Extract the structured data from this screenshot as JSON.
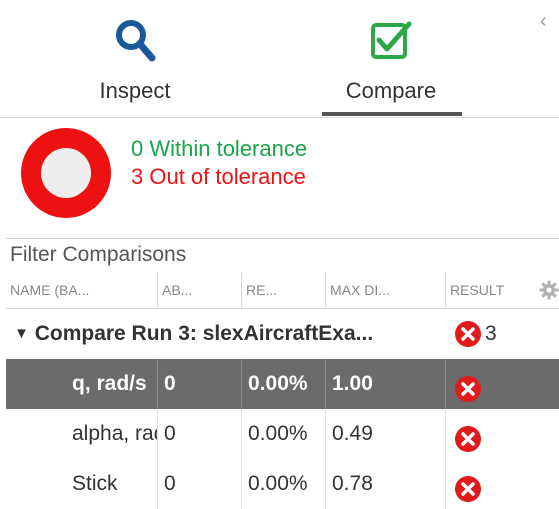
{
  "tabs": {
    "inspect": {
      "label": "Inspect",
      "icon": "search-icon"
    },
    "compare": {
      "label": "Compare",
      "icon": "checkbox-icon"
    }
  },
  "collapse_icon": "chevron-left-icon",
  "summary": {
    "within_text": "0 Within tolerance",
    "out_text": "3 Out of tolerance",
    "within_count": 0,
    "out_count": 3,
    "within_color": "#1aa34a",
    "out_color": "#ee1111"
  },
  "filter": {
    "placeholder": "Filter Comparisons"
  },
  "columns": [
    "NAME (BA...",
    "AB...",
    "RE...",
    "MAX DI...",
    "RESULT"
  ],
  "group": {
    "label": "Compare Run 3: slexAircraftExa...",
    "count": "3"
  },
  "rows": [
    {
      "name": "q, rad/s",
      "abs": "0",
      "rel": "0.00%",
      "max": "1.00",
      "selected": true
    },
    {
      "name": "alpha, rad",
      "abs": "0",
      "rel": "0.00%",
      "max": "0.49",
      "selected": false
    },
    {
      "name": "Stick",
      "abs": "0",
      "rel": "0.00%",
      "max": "0.78",
      "selected": false
    }
  ],
  "colors": {
    "accent": "#1a5a9a",
    "compare_green": "#2aa84a",
    "selected_row": "#6b6b6b",
    "fail": "#e01b1b"
  }
}
